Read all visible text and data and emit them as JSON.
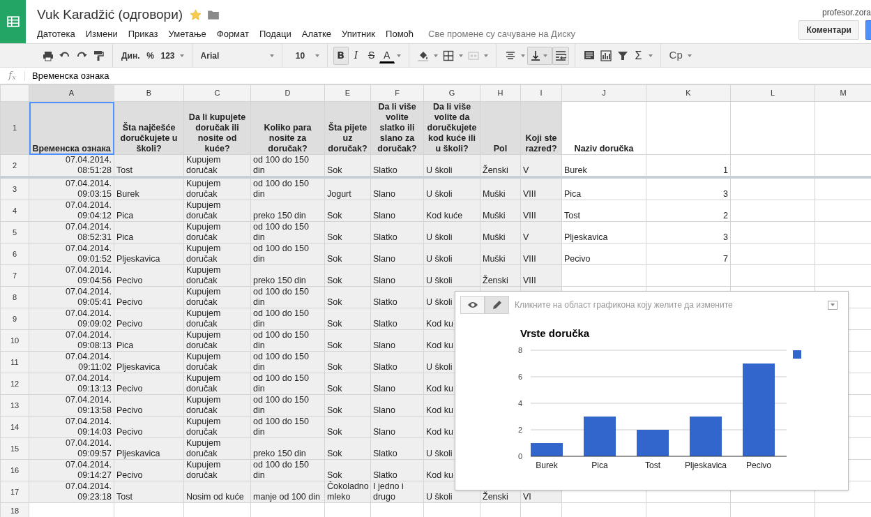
{
  "app": {
    "title": "Vuk Karadžić (одговори)",
    "starred": true,
    "menu": [
      "Датотека",
      "Измени",
      "Приказ",
      "Уметање",
      "Формат",
      "Подаци",
      "Алатке",
      "Упитник",
      "Помоћ"
    ],
    "save_status": "Све промене су сачуване на Диску",
    "user": "profesor.zora",
    "comments_button": "Коментари"
  },
  "toolbar": {
    "number_formats": [
      "Дин.",
      "%",
      "123"
    ],
    "font": "Arial",
    "font_size": "10",
    "format_buttons": [
      {
        "kind": "bold",
        "label": "B",
        "on": true
      },
      {
        "kind": "italic",
        "label": "I",
        "on": false
      },
      {
        "kind": "strike",
        "label": "S",
        "on": false
      },
      {
        "kind": "color",
        "label": "A",
        "on": false
      }
    ],
    "valign_on": true,
    "wrap_on": true,
    "sum_label": "Σ",
    "input_tools": "Ср"
  },
  "formula_bar": {
    "label": "f$_{x}$",
    "content": "Временска ознака"
  },
  "sheet": {
    "columns": [
      {
        "label": "A",
        "selected": true
      },
      {
        "label": "B",
        "selected": false
      },
      {
        "label": "C",
        "selected": false
      },
      {
        "label": "D",
        "selected": false
      },
      {
        "label": "E",
        "selected": false
      },
      {
        "label": "F",
        "selected": false
      },
      {
        "label": "G",
        "selected": false
      },
      {
        "label": "H",
        "selected": false
      },
      {
        "label": "I",
        "selected": false
      },
      {
        "label": "J",
        "selected": false
      },
      {
        "label": "K",
        "selected": false
      },
      {
        "label": "L",
        "selected": false
      },
      {
        "label": "M",
        "selected": false
      }
    ],
    "rows": [
      {
        "number": "1",
        "selected": true,
        "cells": {
          "A": "Временска ознака",
          "B": "Šta najčešće doručkujete u školi?",
          "C": "Da li kupujete doručak ili nosite od kuće?",
          "D": "Koliko para nosite za doručak?",
          "E": "Šta pijete uz doručak?",
          "F": "Da li više volite slatko ili slano za doručak?",
          "G": "Da li više volite da doručkujete kod kuće ili u školi?",
          "H": "Pol",
          "I": "Koji ste razred?",
          "J": "Naziv doručka"
        }
      },
      {
        "number": "2",
        "selected": false,
        "cells": {
          "A": "07.04.2014. 08:51:28",
          "B": "Tost",
          "C": "Kupujem doručak",
          "D": "od 100 do 150 din",
          "E": "Sok",
          "F": "Slatko",
          "G": "U školi",
          "H": "Ženski",
          "I": "V",
          "J": "Burek",
          "K": "1"
        }
      },
      {
        "number": "3",
        "selected": false,
        "cells": {
          "A": "07.04.2014. 09:03:15",
          "B": "Burek",
          "C": "Kupujem doručak",
          "D": "od 100 do 150 din",
          "E": "Jogurt",
          "F": "Slano",
          "G": "U školi",
          "H": "Muški",
          "I": "VIII",
          "J": "Pica",
          "K": "3"
        }
      },
      {
        "number": "4",
        "selected": false,
        "cells": {
          "A": "07.04.2014. 09:04:12",
          "B": "Pica",
          "C": "Kupujem doručak",
          "D": "preko 150 din",
          "E": "Sok",
          "F": "Slano",
          "G": "Kod kuće",
          "H": "Muški",
          "I": "VIII",
          "J": "Tost",
          "K": "2"
        }
      },
      {
        "number": "5",
        "selected": false,
        "cells": {
          "A": "07.04.2014. 08:52:31",
          "B": "Pica",
          "C": "Kupujem doručak",
          "D": "od 100 do 150 din",
          "E": "Sok",
          "F": "Slatko",
          "G": "U školi",
          "H": "Muški",
          "I": "V",
          "J": "Pljeskavica",
          "K": "3"
        }
      },
      {
        "number": "6",
        "selected": false,
        "cells": {
          "A": "07.04.2014. 09:01:52",
          "B": "Pljeskavica",
          "C": "Kupujem doručak",
          "D": "od 100 do 150 din",
          "E": "Sok",
          "F": "Slano",
          "G": "U školi",
          "H": "Muški",
          "I": "VIII",
          "J": "Pecivo",
          "K": "7"
        }
      },
      {
        "number": "7",
        "selected": false,
        "cells": {
          "A": "07.04.2014. 09:04:56",
          "B": "Pecivo",
          "C": "Kupujem doručak",
          "D": "preko 150 din",
          "E": "Sok",
          "F": "Slano",
          "G": "U školi",
          "H": "Ženski",
          "I": "VIII"
        }
      },
      {
        "number": "8",
        "selected": false,
        "cells": {
          "A": "07.04.2014. 09:05:41",
          "B": "Pecivo",
          "C": "Kupujem doručak",
          "D": "od 100 do 150 din",
          "E": "Sok",
          "F": "Slatko",
          "G": "U školi"
        }
      },
      {
        "number": "9",
        "selected": false,
        "cells": {
          "A": "07.04.2014. 09:09:02",
          "B": "Pecivo",
          "C": "Kupujem doručak",
          "D": "od 100 do 150 din",
          "E": "Sok",
          "F": "Slatko",
          "G": "Kod ku"
        }
      },
      {
        "number": "10",
        "selected": false,
        "cells": {
          "A": "07.04.2014. 09:08:13",
          "B": "Pica",
          "C": "Kupujem doručak",
          "D": "od 100 do 150 din",
          "E": "Sok",
          "F": "Slano",
          "G": "Kod ku"
        }
      },
      {
        "number": "11",
        "selected": false,
        "cells": {
          "A": "07.04.2014. 09:11:02",
          "B": "Pljeskavica",
          "C": "Kupujem doručak",
          "D": "od 100 do 150 din",
          "E": "Sok",
          "F": "Slatko",
          "G": "U školi"
        }
      },
      {
        "number": "12",
        "selected": false,
        "cells": {
          "A": "07.04.2014. 09:13:13",
          "B": "Pecivo",
          "C": "Kupujem doručak",
          "D": "od 100 do 150 din",
          "E": "Sok",
          "F": "Slano",
          "G": "Kod ku"
        }
      },
      {
        "number": "13",
        "selected": false,
        "cells": {
          "A": "07.04.2014. 09:13:58",
          "B": "Pecivo",
          "C": "Kupujem doručak",
          "D": "od 100 do 150 din",
          "E": "Sok",
          "F": "Slano",
          "G": "Kod ku"
        }
      },
      {
        "number": "14",
        "selected": false,
        "cells": {
          "A": "07.04.2014. 09:14:03",
          "B": "Pecivo",
          "C": "Kupujem doručak",
          "D": "od 100 do 150 din",
          "E": "Sok",
          "F": "Slano",
          "G": "Kod ku"
        }
      },
      {
        "number": "15",
        "selected": false,
        "cells": {
          "A": "07.04.2014. 09:09:57",
          "B": "Pljeskavica",
          "C": "Kupujem doručak",
          "D": "preko 150 din",
          "E": "Sok",
          "F": "Slatko",
          "G": "U školi"
        }
      },
      {
        "number": "16",
        "selected": false,
        "cells": {
          "A": "07.04.2014. 09:14:27",
          "B": "Pecivo",
          "C": "Kupujem doručak",
          "D": "od 100 do 150 din",
          "E": "Sok",
          "F": "Slatko",
          "G": "Kod ku"
        }
      },
      {
        "number": "17",
        "selected": false,
        "cells": {
          "A": "07.04.2014. 09:23:18",
          "B": "Tost",
          "C": "Nosim od kuće",
          "D": "manje od 100 din",
          "E": "Čokoladno mleko",
          "F": "I jedno i drugo",
          "G": "U školi",
          "H": "Ženski",
          "I": "VI"
        }
      },
      {
        "number": "18",
        "selected": false
      }
    ]
  },
  "chart": {
    "hint": "Кликните на област графикона коју желите да измените",
    "modes": [
      {
        "selected": false
      },
      {
        "selected": true
      }
    ],
    "chart_data": {
      "type": "bar",
      "title": "Vrste doručka",
      "categories": [
        "Burek",
        "Pica",
        "Tost",
        "Pljeskavica",
        "Pecivo"
      ],
      "series": [
        {
          "color": "#3366cc",
          "values": [
            1,
            3,
            2,
            3,
            7
          ]
        }
      ],
      "ylim": [
        0,
        8
      ],
      "grid": true,
      "yticks": [
        {
          "value": 0,
          "label": "0"
        },
        {
          "value": 2,
          "label": "2"
        },
        {
          "value": 4,
          "label": "4"
        },
        {
          "value": 6,
          "label": "6"
        },
        {
          "value": 8,
          "label": "8"
        }
      ]
    }
  }
}
